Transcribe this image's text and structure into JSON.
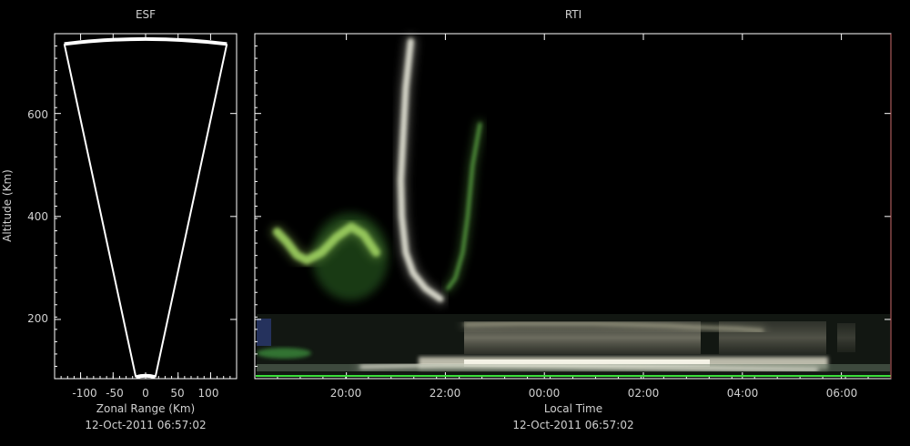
{
  "chart_data": [
    {
      "type": "fan",
      "title": "ESF",
      "xlabel": "Zonal Range (Km)",
      "ylabel": "Altitude (Km)",
      "xticks": [
        "-100",
        "-50",
        "0",
        "50",
        "100"
      ],
      "yticks": [
        "200",
        "400",
        "600"
      ],
      "timestamp": "12-Oct-2011 06:57:02",
      "xlim": [
        -140,
        140
      ],
      "ylim": [
        85,
        755
      ],
      "fan_edges": [
        {
          "bottom": [
            -15,
            88
          ],
          "top": [
            -125,
            735
          ]
        },
        {
          "bottom": [
            15,
            88
          ],
          "top": [
            125,
            735
          ]
        }
      ],
      "colors": {
        "frame": "#ffffff",
        "fan": "#ffffff"
      }
    },
    {
      "type": "heatmap",
      "title": "RTI",
      "xlabel": "Local Time",
      "xticks": [
        "20:00",
        "22:00",
        "00:00",
        "02:00",
        "04:00",
        "06:00"
      ],
      "yticks": [
        "200",
        "400",
        "600"
      ],
      "timestamp": "12-Oct-2011 06:57:02",
      "xlim_hours": [
        18.15,
        31.0
      ],
      "ylim": [
        85,
        755
      ],
      "features": [
        {
          "name": "plume-main",
          "color": "#e6e6d8",
          "points": [
            [
              21.3,
              740
            ],
            [
              21.2,
              650
            ],
            [
              21.15,
              560
            ],
            [
              21.1,
              470
            ],
            [
              21.12,
              400
            ],
            [
              21.2,
              330
            ],
            [
              21.35,
              290
            ],
            [
              21.6,
              260
            ],
            [
              21.9,
              240
            ]
          ]
        },
        {
          "name": "plume-secondary",
          "color": "#6abf50",
          "points": [
            [
              22.7,
              580
            ],
            [
              22.55,
              500
            ],
            [
              22.45,
              400
            ],
            [
              22.35,
              330
            ],
            [
              22.2,
              280
            ],
            [
              22.05,
              260
            ]
          ]
        },
        {
          "name": "green-band",
          "color": "#9ed060",
          "points": [
            [
              18.6,
              370
            ],
            [
              18.8,
              350
            ],
            [
              19.0,
              325
            ],
            [
              19.2,
              315
            ],
            [
              19.5,
              330
            ],
            [
              19.8,
              360
            ],
            [
              20.1,
              380
            ],
            [
              20.35,
              365
            ],
            [
              20.6,
              330
            ]
          ]
        },
        {
          "name": "lower-layer",
          "color": "#a6a48c",
          "points": [
            [
              22.4,
              190
            ],
            [
              23.5,
              192
            ],
            [
              25.0,
              192
            ],
            [
              26.5,
              188
            ],
            [
              27.0,
              185
            ],
            [
              27.9,
              182
            ],
            [
              28.4,
              178
            ]
          ]
        },
        {
          "name": "e-region-bright",
          "color": "#f0efe0",
          "points": [
            [
              20.3,
              108
            ],
            [
              22.0,
              112
            ],
            [
              24.0,
              110
            ],
            [
              26.0,
              107
            ],
            [
              28.0,
              104
            ],
            [
              29.5,
              102
            ]
          ]
        }
      ],
      "colors": {
        "frame": "#ffffff",
        "baseline": "#3adf3a",
        "right_axis": "#c04848"
      }
    }
  ]
}
